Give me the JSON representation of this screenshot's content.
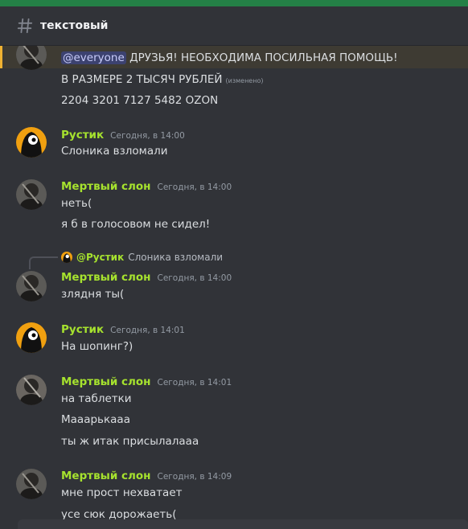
{
  "channel": {
    "name": "текстовый",
    "icon": "hash-icon"
  },
  "colors": {
    "accent": "#248046",
    "author": "#a6e22e",
    "mention_bar": "#f0b232"
  },
  "messages": [
    {
      "author": "",
      "lines": [
        "ДРУЗЬЯ! НЕОБХОДИМА ПОСИЛЬНАЯ ПОМОЩЬ!",
        "В РАЗМЕРЕ 2 ТЫСЯЧ РУБЛЕЙ",
        "2204 3201 7127 5482 OZON"
      ],
      "mention": "@everyone",
      "edited": "(изменено)"
    },
    {
      "author": "Рустик",
      "time": "Сегодня, в 14:00",
      "lines": [
        "Слоника взломали"
      ]
    },
    {
      "author": "Мертвый слон",
      "time": "Сегодня, в 14:00",
      "lines": [
        "неть(",
        "я б в голосовом не сидел!"
      ]
    },
    {
      "reply": {
        "name": "@Рустик",
        "text": "Слоника взломали"
      },
      "author": "Мертвый слон",
      "time": "Сегодня, в 14:00",
      "lines": [
        "злядня ты("
      ]
    },
    {
      "author": "Рустик",
      "time": "Сегодня, в 14:01",
      "lines": [
        "На шопинг?)"
      ]
    },
    {
      "author": "Мертвый слон",
      "time": "Сегодня, в 14:01",
      "lines": [
        "на таблетки",
        "Мааарькааа",
        "ты ж итак присылалааа"
      ]
    },
    {
      "author": "Мертвый слон",
      "time": "Сегодня, в 14:09",
      "lines": [
        "мне прост нехватает",
        "усе сюк дорожаеть("
      ]
    }
  ]
}
